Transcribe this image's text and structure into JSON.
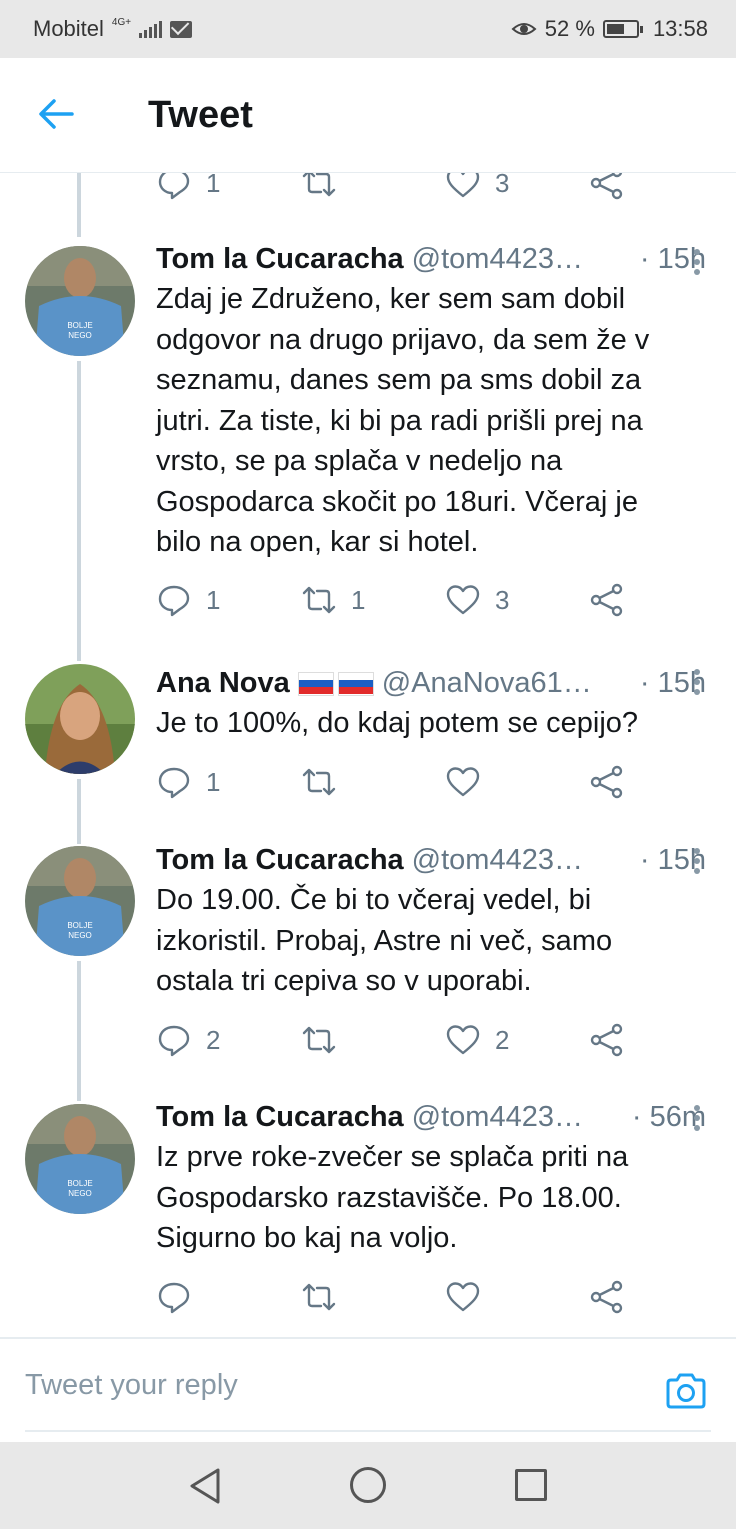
{
  "status_bar": {
    "carrier": "Mobitel",
    "network": "4G+",
    "battery_percent": "52 %",
    "time": "13:58"
  },
  "app_bar": {
    "title": "Tweet"
  },
  "partial_tweet_actions": {
    "reply_count": "1",
    "retweet_count": "",
    "like_count": "3"
  },
  "tweets": [
    {
      "name": "Tom la Cucaracha",
      "handle": "@tom4423…",
      "time": "· 15h",
      "text": "Zdaj je Združeno, ker sem sam dobil odgovor na drugo prijavo, da sem že v seznamu, danes sem pa sms dobil za jutri. Za tiste, ki bi pa radi prišli prej na vrsto, se pa splača v nedeljo na Gospodarca skočit po 18uri. Včeraj je bilo na open, kar si hotel.",
      "reply_count": "1",
      "retweet_count": "1",
      "like_count": "3"
    },
    {
      "name": "Ana Nova",
      "handle": "@AnaNova61…",
      "time": "· 15h",
      "text": "Je to 100%, do kdaj potem se cepijo?",
      "reply_count": "1",
      "retweet_count": "",
      "like_count": ""
    },
    {
      "name": "Tom la Cucaracha",
      "handle": "@tom4423…",
      "time": "· 15h",
      "text": "Do 19.00. Če bi to včeraj vedel, bi izkoristil. Probaj, Astre ni več, samo ostala tri cepiva so v uporabi.",
      "reply_count": "2",
      "retweet_count": "",
      "like_count": "2"
    },
    {
      "name": "Tom la Cucaracha",
      "handle": "@tom4423…",
      "time": "· 56m",
      "text": "Iz prve roke-zvečer se splača priti na Gospodarsko razstavišče. Po 18.00. Sigurno bo kaj na voljo.",
      "reply_count": "",
      "retweet_count": "",
      "like_count": ""
    }
  ],
  "reply_bar": {
    "placeholder": "Tweet your reply"
  },
  "colors": {
    "accent": "#1da1f2",
    "text": "#14171a",
    "secondary": "#657786",
    "thread_line": "#ccd6dd"
  }
}
